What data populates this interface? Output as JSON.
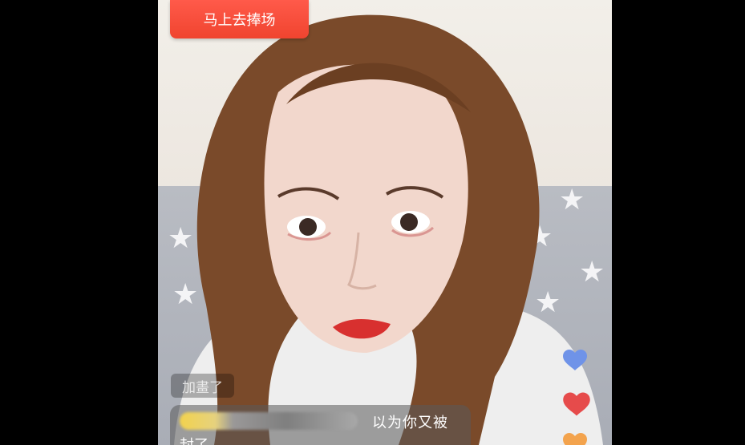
{
  "banner": {
    "label": "马上去捧场"
  },
  "comments": {
    "faded_text": "加畫了",
    "bubble_line1": "以为你又被",
    "bubble_line2": "封了"
  },
  "colors": {
    "banner": "#f0442f",
    "heart_blue": "#6f93e8",
    "heart_red": "#e64b4b"
  }
}
